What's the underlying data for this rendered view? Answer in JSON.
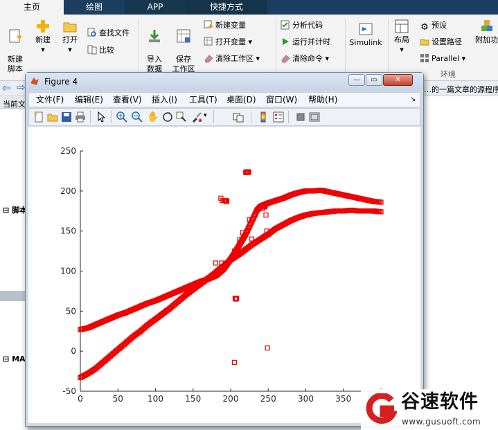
{
  "tabs": [
    {
      "label": "主页",
      "selected": true
    },
    {
      "label": "绘图"
    },
    {
      "label": "APP"
    },
    {
      "label": "快捷方式"
    }
  ],
  "ribbon": {
    "new_script": "新建\n脚本",
    "new": "新建",
    "open": "打开",
    "find_files": "查找文件",
    "compare": "比较",
    "import_data": "导入\n数据",
    "save_workspace": "保存\n工作区",
    "new_variable": "新建变量",
    "open_variable": "打开变量",
    "clear_workspace": "清除工作区",
    "analyze_code": "分析代码",
    "run_and_time": "运行并计时",
    "clear_commands": "清除命令",
    "simulink": "Simulink",
    "layout": "布局",
    "preferences": "预设",
    "set_path": "设置路径",
    "parallel": "Parallel",
    "addons": "附加功",
    "environment": "环境"
  },
  "address": {
    "tail": "…的一篇文章的源程序"
  },
  "left_panel": {
    "current": "当前文",
    "script_label": "脚本",
    "ma_label": "MA"
  },
  "figure": {
    "title": "Figure 4",
    "menus": [
      "文件(F)",
      "编辑(E)",
      "查看(V)",
      "插入(I)",
      "工具(T)",
      "桌面(D)",
      "窗口(W)",
      "帮助(H)"
    ]
  },
  "colors": {
    "marker": "#ee0000",
    "accent": "#1b3d5f"
  },
  "chart_data": {
    "type": "scatter",
    "xlim": [
      0,
      400
    ],
    "ylim": [
      -50,
      250
    ],
    "xticks": [
      0,
      50,
      100,
      150,
      200,
      250,
      300,
      350,
      400
    ],
    "yticks": [
      -50,
      0,
      50,
      100,
      150,
      200,
      250
    ],
    "xtick_labels": [
      "0",
      "50",
      "100",
      "150",
      "200",
      "250",
      "300",
      "350",
      "400"
    ],
    "ytick_labels": [
      "-50",
      "0",
      "50",
      "100",
      "150",
      "200",
      "250"
    ],
    "marker": "square",
    "grid": false,
    "title": "",
    "xlabel": "",
    "ylabel": "",
    "series": [
      {
        "x": [
          0,
          10,
          20,
          30,
          40,
          50,
          60,
          70,
          80,
          90,
          100,
          110,
          120,
          130,
          140,
          150,
          160,
          170,
          180,
          185,
          190,
          200,
          210,
          220,
          230,
          240,
          250,
          260,
          270,
          280,
          290,
          300,
          310,
          320,
          330,
          340,
          350,
          360,
          370,
          380,
          390,
          400
        ],
        "y": [
          -33,
          -28,
          -22,
          -14,
          -6,
          2,
          10,
          18,
          25,
          33,
          40,
          47,
          54,
          62,
          70,
          77,
          84,
          91,
          98,
          102,
          106,
          114,
          120,
          127,
          134,
          140,
          146,
          153,
          158,
          163,
          167,
          170,
          172,
          173,
          174,
          175,
          175,
          176,
          175,
          175,
          175,
          174
        ]
      },
      {
        "x": [
          0,
          10,
          20,
          30,
          40,
          50,
          60,
          70,
          80,
          90,
          100,
          110,
          120,
          130,
          140,
          150,
          160,
          170,
          180,
          185,
          190,
          195,
          200,
          205,
          210,
          215,
          220,
          225,
          230,
          235,
          240,
          245,
          250,
          260,
          270,
          280,
          290,
          300,
          310,
          320,
          330,
          340,
          350,
          360,
          370,
          380,
          390,
          400
        ],
        "y": [
          27,
          29,
          33,
          37,
          41,
          45,
          48,
          52,
          56,
          60,
          63,
          67,
          71,
          75,
          79,
          83,
          87,
          90,
          94,
          98,
          102,
          108,
          115,
          122,
          130,
          138,
          146,
          156,
          166,
          176,
          181,
          183,
          185,
          188,
          191,
          195,
          198,
          200,
          200,
          201,
          199,
          197,
          195,
          193,
          191,
          189,
          187,
          186
        ]
      },
      {
        "x": [
          187,
          189,
          191,
          192,
          193,
          193,
          194,
          194,
          195,
          205,
          206,
          206,
          207,
          208,
          220,
          221,
          222,
          223,
          224,
          212,
          216,
          222,
          225,
          228,
          230,
          242,
          245,
          246,
          247,
          248,
          249,
          205,
          208,
          246,
          180,
          188
        ],
        "y": [
          191,
          188,
          188,
          188,
          188,
          188,
          187,
          188,
          187,
          -14,
          66,
          66,
          65,
          66,
          223,
          224,
          224,
          223,
          224,
          139,
          148,
          150,
          164,
          140,
          135,
          178,
          180,
          182,
          170,
          150,
          4,
          125,
          127,
          181,
          110,
          110
        ]
      }
    ]
  }
}
